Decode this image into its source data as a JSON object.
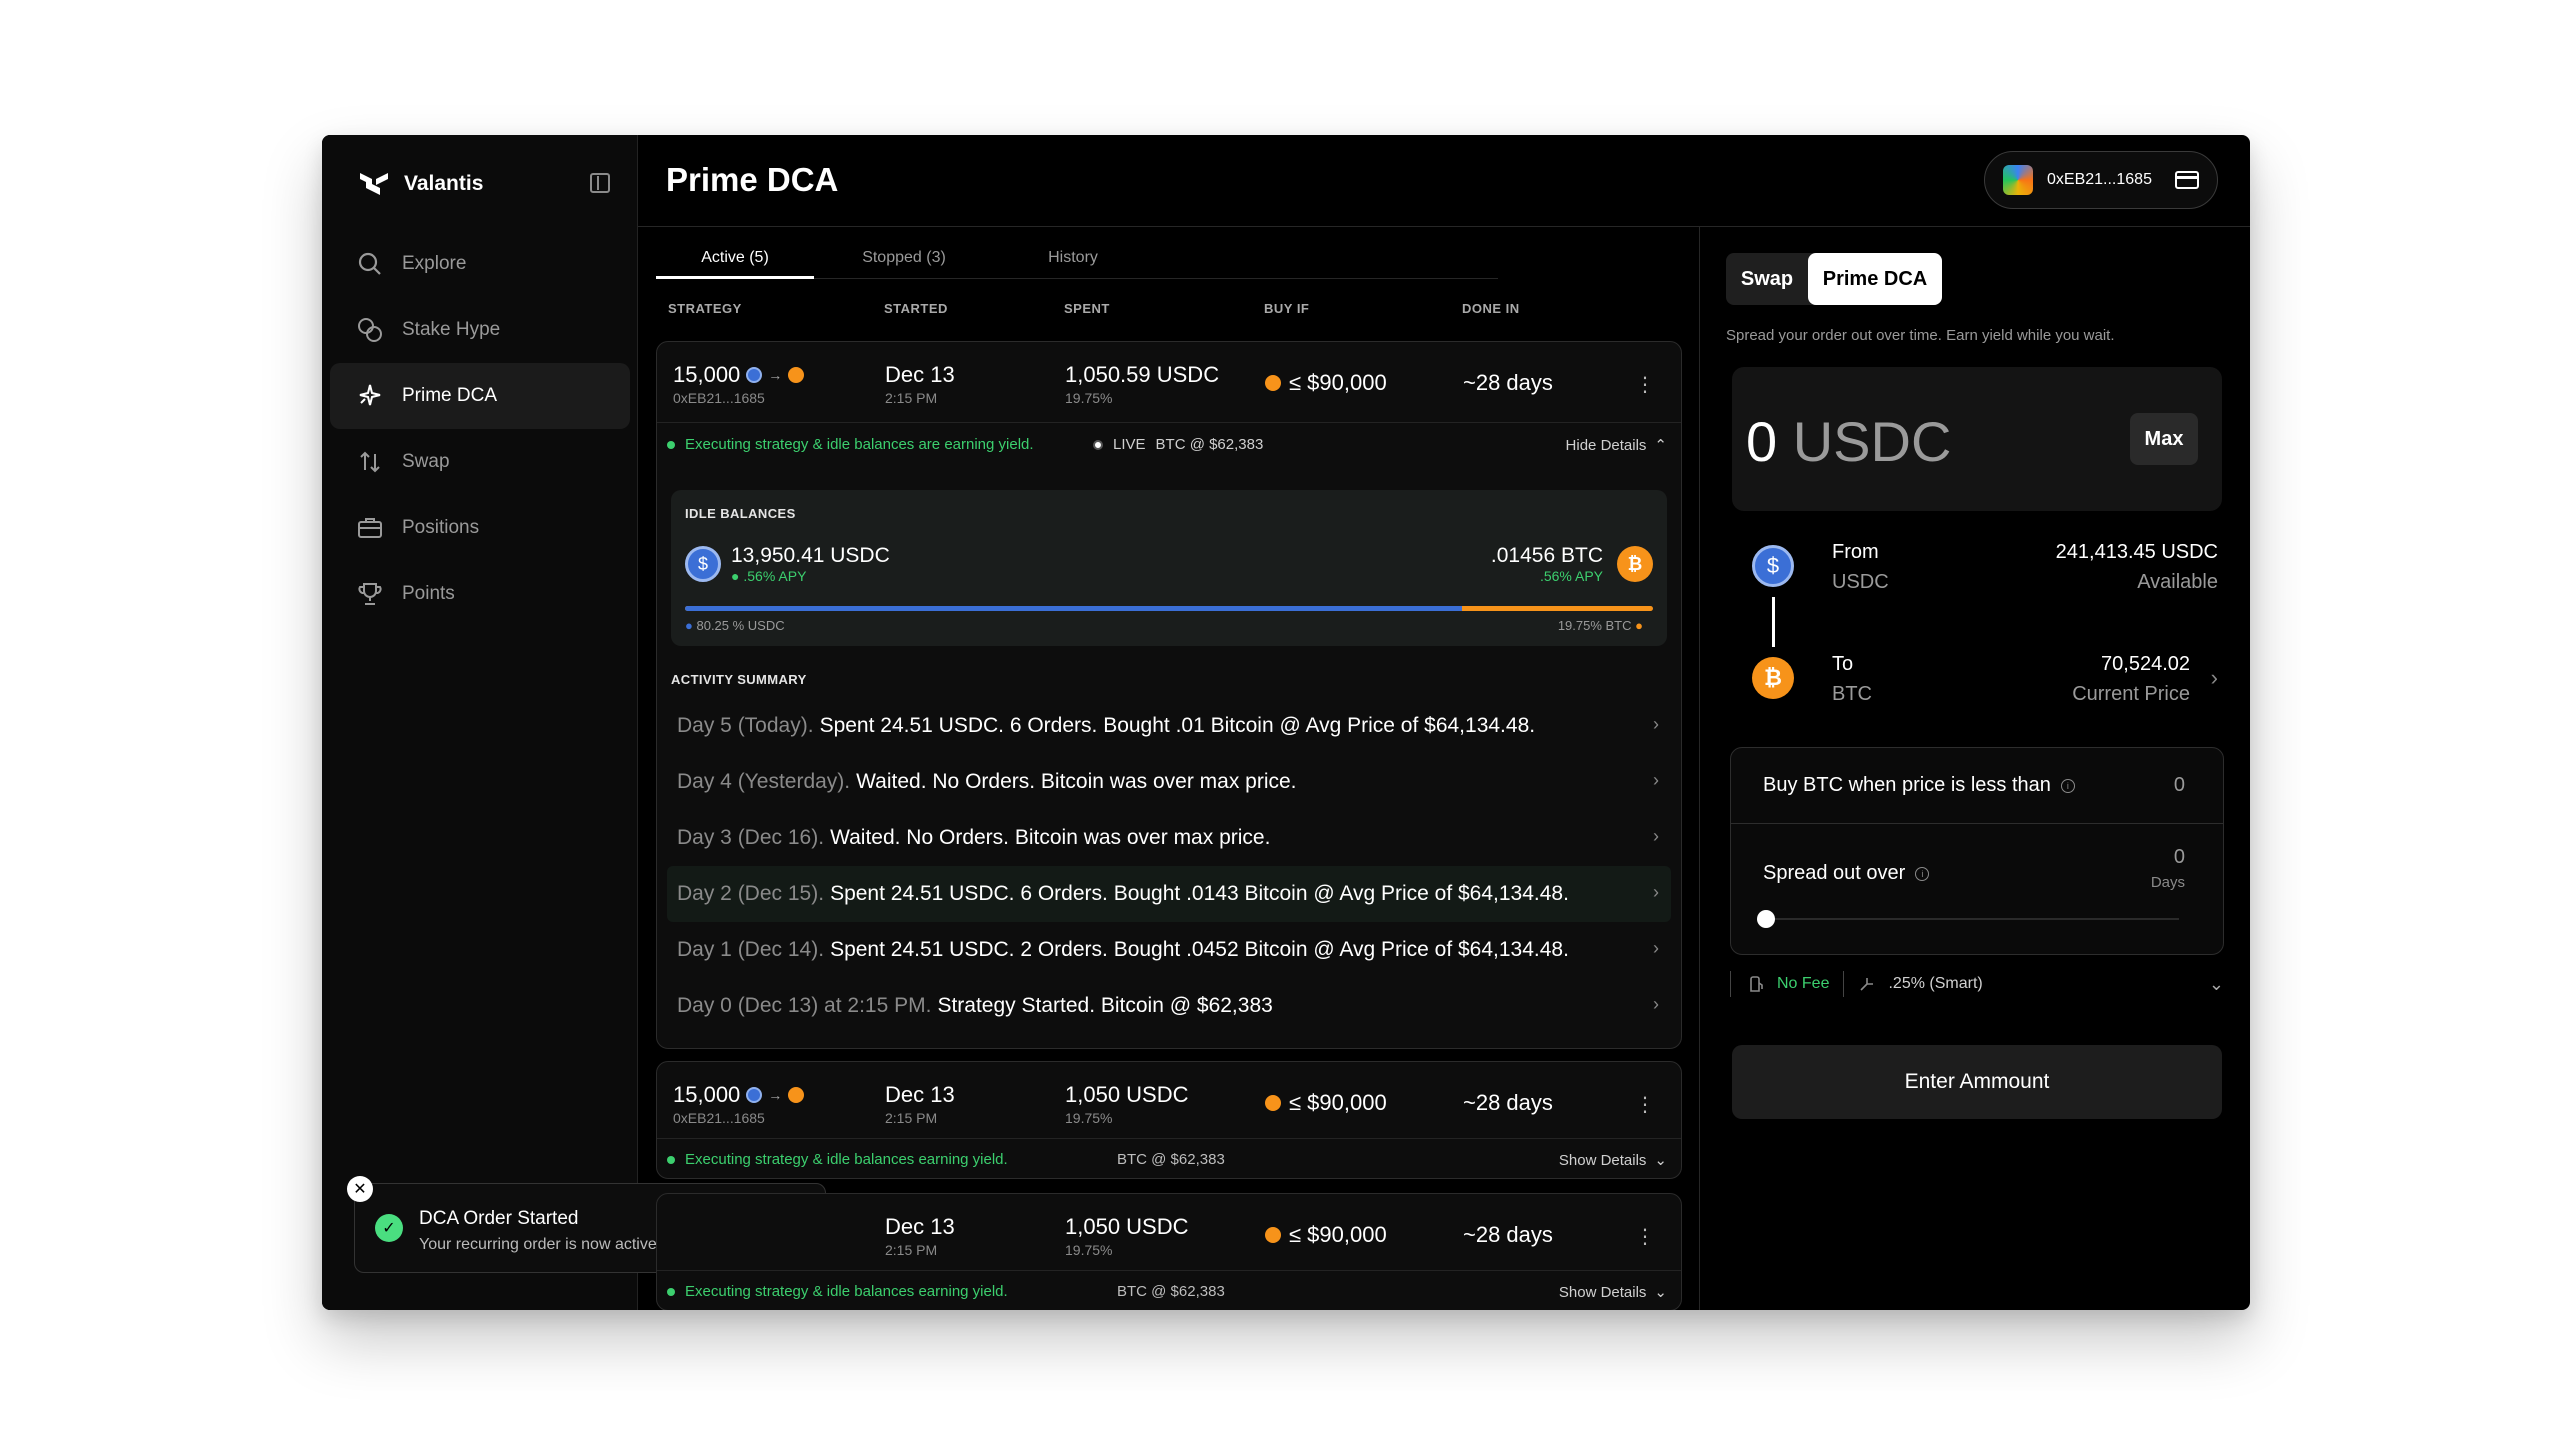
{
  "brand": {
    "name": "Valantis"
  },
  "sidebar": {
    "items": [
      {
        "label": "Explore",
        "icon": "search-icon"
      },
      {
        "label": "Stake Hype",
        "icon": "coins-icon"
      },
      {
        "label": "Prime DCA",
        "icon": "sparkle-icon"
      },
      {
        "label": "Swap",
        "icon": "arrows-up-down-icon"
      },
      {
        "label": "Positions",
        "icon": "briefcase-icon"
      },
      {
        "label": "Points",
        "icon": "trophy-icon"
      }
    ],
    "active": "Prime DCA"
  },
  "header": {
    "title": "Prime DCA",
    "wallet_address": "0xEB21...1685"
  },
  "tabs": [
    {
      "label": "Active (5)",
      "active": true
    },
    {
      "label": "Stopped (3)",
      "active": false
    },
    {
      "label": "History",
      "active": false
    }
  ],
  "columns": {
    "strategy": "STRATEGY",
    "started": "STARTED",
    "spent": "SPENT",
    "buy_if": "BUY IF",
    "done_in": "DONE IN"
  },
  "strategies": [
    {
      "amount": "15,000",
      "address": "0xEB21...1685",
      "started_date": "Dec 13",
      "started_time": "2:15 PM",
      "spent": "1,050.59 USDC",
      "spent_pct": "19.75%",
      "buy_if": "≤ $90,000",
      "done_in": "~28 days",
      "status": "Executing strategy & idle balances are earning yield.",
      "live_label": "LIVE",
      "btc_price": "BTC @ $62,383",
      "details_label": "Hide Details"
    },
    {
      "amount": "15,000",
      "address": "0xEB21...1685",
      "started_date": "Dec 13",
      "started_time": "2:15 PM",
      "spent": "1,050 USDC",
      "spent_pct": "19.75%",
      "buy_if": "≤ $90,000",
      "done_in": "~28 days",
      "status": "Executing strategy & idle balances earning yield.",
      "btc_price": "BTC @ $62,383",
      "details_label": "Show Details"
    },
    {
      "started_date": "Dec 13",
      "started_time": "2:15 PM",
      "spent": "1,050 USDC",
      "spent_pct": "19.75%",
      "buy_if": "≤ $90,000",
      "done_in": "~28 days",
      "status": "Executing strategy & idle balances earning yield.",
      "btc_price": "BTC @ $62,383",
      "details_label": "Show Details"
    }
  ],
  "idle": {
    "title": "IDLE BALANCES",
    "usdc_balance": "13,950.41 USDC",
    "usdc_apy": ".56% APY",
    "btc_balance": ".01456 BTC",
    "btc_apy": ".56% APY",
    "usdc_share": 0.8025,
    "usdc_share_label": "80.25 % USDC",
    "btc_share_label": "19.75% BTC"
  },
  "activity": {
    "title": "ACTIVITY SUMMARY",
    "items": [
      {
        "day": "Day 5 (Today).",
        "text": "Spent 24.51 USDC. 6 Orders. Bought .01 Bitcoin @ Avg Price of $64,134.48."
      },
      {
        "day": "Day 4 (Yesterday).",
        "text": "Waited. No Orders. Bitcoin was over max price."
      },
      {
        "day": "Day 3 (Dec 16).",
        "text": "Waited. No Orders. Bitcoin was over max price."
      },
      {
        "day": "Day 2 (Dec 15).",
        "text": "Spent 24.51 USDC. 6 Orders. Bought .0143 Bitcoin @ Avg Price of $64,134.48."
      },
      {
        "day": "Day 1 (Dec 14).",
        "text": "Spent 24.51 USDC. 2 Orders. Bought .0452 Bitcoin @ Avg Price of $64,134.48."
      },
      {
        "day": "Day 0 (Dec 13) at 2:15 PM.",
        "text": "Strategy Started. Bitcoin @ $62,383"
      }
    ]
  },
  "toast": {
    "title": "DCA Order Started",
    "message": "Your recurring order is now active"
  },
  "panel": {
    "swap_label": "Swap",
    "dca_label": "Prime DCA",
    "tagline": "Spread your order out over time. Earn yield while you wait.",
    "amount": "0",
    "amount_unit": "USDC",
    "max_label": "Max",
    "from_label": "From",
    "from_token": "USDC",
    "from_value": "241,413.45 USDC",
    "from_value_sub": "Available",
    "to_label": "To",
    "to_token": "BTC",
    "to_value": "70,524.02",
    "to_value_sub": "Current Price",
    "buy_label": "Buy BTC when price is less than",
    "buy_value": "0",
    "spread_label": "Spread out over",
    "spread_value": "0",
    "spread_unit": "Days",
    "fee_label": "No Fee",
    "smart_label": ".25% (Smart)",
    "enter_label": "Enter Ammount"
  },
  "colors": {
    "green": "#3ccf6e",
    "usdc": "#3b6fd6",
    "btc": "#f7931a",
    "bg": "#000000"
  }
}
